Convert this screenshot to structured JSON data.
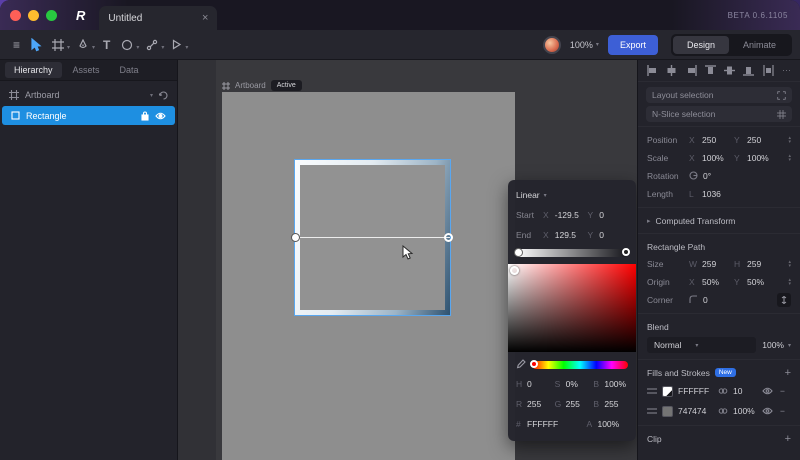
{
  "titlebar": {
    "logo": "R",
    "tab_title": "Untitled",
    "beta_label": "BETA 0.6.1105"
  },
  "icons": {
    "menu": "≡",
    "chevron_down": "▾",
    "chevron_right": "▸",
    "ellipsis": "⋯",
    "plus": "+",
    "minus": "−",
    "close": "×",
    "text_tool": "T",
    "stepper_up": "▴",
    "stepper_down": "▾"
  },
  "toolbar": {
    "zoom": "100%",
    "export_label": "Export",
    "design_label": "Design",
    "animate_label": "Animate"
  },
  "sidebar": {
    "tabs": {
      "hierarchy": "Hierarchy",
      "assets": "Assets",
      "data": "Data"
    },
    "artboard_label": "Artboard",
    "rectangle_label": "Rectangle"
  },
  "canvas": {
    "artboard_label": "Artboard",
    "active_badge": "Active"
  },
  "gradient_panel": {
    "type": "Linear",
    "start_label": "Start",
    "end_label": "End",
    "x_label": "X",
    "y_label": "Y",
    "start_x": "-129.5",
    "start_y": "0",
    "end_x": "129.5",
    "end_y": "0",
    "h_label": "H",
    "h": "0",
    "s_label": "S",
    "s": "0%",
    "b_label": "B",
    "b": "100%",
    "r_label": "R",
    "r": "255",
    "g_label": "G",
    "g": "255",
    "b2_label": "B",
    "b2": "255",
    "hex_label": "#",
    "hex": "FFFFFF",
    "a_label": "A",
    "a": "100%"
  },
  "inspector": {
    "layout_selection": "Layout selection",
    "nslice_selection": "N-Slice selection",
    "x_label": "X",
    "y_label": "Y",
    "w_label": "W",
    "h_label": "H",
    "l_label": "L",
    "position_label": "Position",
    "position_x": "250",
    "position_y": "250",
    "scale_label": "Scale",
    "scale_x": "100%",
    "scale_y": "100%",
    "rotation_label": "Rotation",
    "rotation": "0°",
    "length_label": "Length",
    "length": "1036",
    "computed_transform": "Computed Transform",
    "rectangle_path": "Rectangle Path",
    "size_label": "Size",
    "size_w": "259",
    "size_h": "259",
    "origin_label": "Origin",
    "origin_x": "50%",
    "origin_y": "50%",
    "corner_label": "Corner",
    "corner": "0",
    "blend_title": "Blend",
    "blend_mode": "Normal",
    "blend_opacity": "100%",
    "fills_title": "Fills and Strokes",
    "new_badge": "New",
    "fill1_hex": "FFFFFF",
    "fill1_value": "10",
    "fill2_hex": "747474",
    "fill2_value": "100%",
    "clip_title": "Clip"
  }
}
